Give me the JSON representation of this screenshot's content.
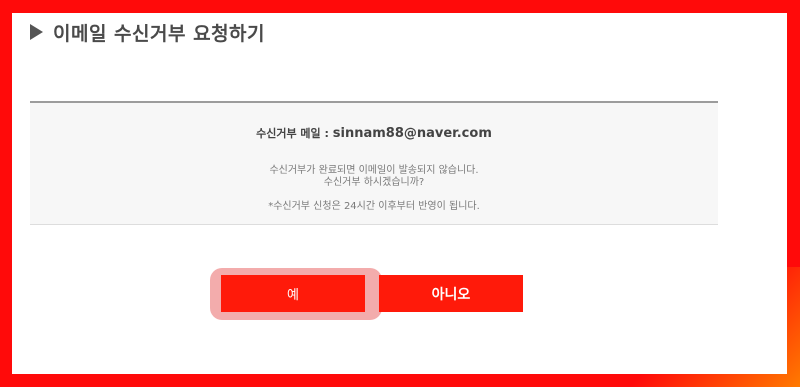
{
  "dialog": {
    "title": "이메일 수신거부 요청하기"
  },
  "notice": {
    "email_label": "수신거부 메일",
    "separator": " : ",
    "email": "sinnam88@naver.com",
    "message1": "수신거부가 완료되면 이메일이 발송되지 않습니다.",
    "message2": "수신거부 하시겠습니까?",
    "message3": "*수신거부 신청은 24시간 이후부터 반영이 됩니다."
  },
  "buttons": {
    "yes_label": "예",
    "no_label": "아니오"
  },
  "colors": {
    "primary_red": "#ff1a0a",
    "focus_ring": "#f2a3a3",
    "background_red": "#ff0a0a",
    "background_orange": "#ff7a00"
  }
}
